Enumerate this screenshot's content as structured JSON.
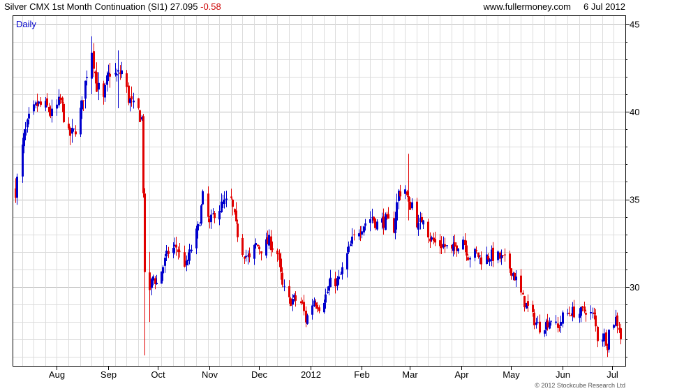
{
  "header": {
    "instrument": "Silver CMX 1st Month Continuation (SI1)",
    "last": "27.095",
    "change": "-0.58",
    "site": "www.fullermoney.com",
    "date": "6 Jul 2012"
  },
  "chart_data": {
    "type": "candlestick",
    "period_label": "Daily",
    "copyright": "© 2012 Stockcube Research Ltd",
    "ylim": [
      25.5,
      45.5
    ],
    "y_ticks": [
      30,
      35,
      40,
      45
    ],
    "grid": true,
    "x_domain": [
      "2011-07-07",
      "2012-07-06"
    ],
    "x_ticks": [
      {
        "date": "2011-08-01",
        "label": "Aug"
      },
      {
        "date": "2011-09-01",
        "label": "Sep"
      },
      {
        "date": "2011-10-01",
        "label": "Oct"
      },
      {
        "date": "2011-11-01",
        "label": "Nov"
      },
      {
        "date": "2011-12-01",
        "label": "Dec"
      },
      {
        "date": "2012-01-01",
        "label": "2012"
      },
      {
        "date": "2012-02-01",
        "label": "Feb"
      },
      {
        "date": "2012-03-01",
        "label": "Mar"
      },
      {
        "date": "2012-04-01",
        "label": "Apr"
      },
      {
        "date": "2012-05-01",
        "label": "May"
      },
      {
        "date": "2012-06-01",
        "label": "Jun"
      },
      {
        "date": "2012-07-01",
        "label": "Jul"
      }
    ],
    "colors": {
      "up": "#0000cc",
      "down": "#e00000",
      "grid": "#dcdcdc",
      "grid_major": "#bdbdbd",
      "axis": "#000000"
    },
    "close_path": [
      [
        "2011-07-07",
        35.5
      ],
      [
        "2011-07-12",
        38.5
      ],
      [
        "2011-07-15",
        39.5
      ],
      [
        "2011-07-20",
        40.4
      ],
      [
        "2011-07-26",
        40.2
      ],
      [
        "2011-07-29",
        39.8
      ],
      [
        "2011-08-03",
        40.6
      ],
      [
        "2011-08-08",
        38.6
      ],
      [
        "2011-08-11",
        38.8
      ],
      [
        "2011-08-16",
        40.3
      ],
      [
        "2011-08-19",
        42.3
      ],
      [
        "2011-08-22",
        43.6
      ],
      [
        "2011-08-25",
        41.5
      ],
      [
        "2011-08-29",
        40.6
      ],
      [
        "2011-08-31",
        41.7
      ],
      [
        "2011-09-02",
        42.3
      ],
      [
        "2011-09-06",
        42.0
      ],
      [
        "2011-09-09",
        42.3
      ],
      [
        "2011-09-13",
        40.8
      ],
      [
        "2011-09-16",
        40.2
      ],
      [
        "2011-09-19",
        40.0
      ],
      [
        "2011-09-21",
        39.6
      ],
      [
        "2011-09-22",
        35.6
      ],
      [
        "2011-09-23",
        30.5
      ],
      [
        "2011-09-26",
        29.9
      ],
      [
        "2011-09-28",
        30.6
      ],
      [
        "2011-09-30",
        30.2
      ],
      [
        "2011-10-04",
        31.2
      ],
      [
        "2011-10-07",
        32.0
      ],
      [
        "2011-10-12",
        32.3
      ],
      [
        "2011-10-14",
        31.9
      ],
      [
        "2011-10-18",
        31.2
      ],
      [
        "2011-10-21",
        32.2
      ],
      [
        "2011-10-25",
        33.3
      ],
      [
        "2011-10-28",
        35.1
      ],
      [
        "2011-11-01",
        33.5
      ],
      [
        "2011-11-04",
        34.3
      ],
      [
        "2011-11-09",
        34.7
      ],
      [
        "2011-11-14",
        34.9
      ],
      [
        "2011-11-17",
        33.4
      ],
      [
        "2011-11-21",
        32.1
      ],
      [
        "2011-11-25",
        31.5
      ],
      [
        "2011-11-29",
        32.4
      ],
      [
        "2011-12-02",
        32.2
      ],
      [
        "2011-12-07",
        32.6
      ],
      [
        "2011-12-12",
        31.9
      ],
      [
        "2011-12-15",
        30.0
      ],
      [
        "2011-12-19",
        29.2
      ],
      [
        "2011-12-22",
        29.3
      ],
      [
        "2011-12-27",
        29.0
      ],
      [
        "2011-12-29",
        28.1
      ],
      [
        "2012-01-03",
        29.3
      ],
      [
        "2012-01-06",
        28.9
      ],
      [
        "2012-01-10",
        29.5
      ],
      [
        "2012-01-13",
        30.2
      ],
      [
        "2012-01-18",
        30.4
      ],
      [
        "2012-01-23",
        31.8
      ],
      [
        "2012-01-26",
        32.6
      ],
      [
        "2012-01-30",
        33.3
      ],
      [
        "2012-02-02",
        33.6
      ],
      [
        "2012-02-07",
        34.0
      ],
      [
        "2012-02-10",
        33.6
      ],
      [
        "2012-02-15",
        33.8
      ],
      [
        "2012-02-20",
        33.4
      ],
      [
        "2012-02-23",
        35.4
      ],
      [
        "2012-02-27",
        35.6
      ],
      [
        "2012-02-29",
        34.6
      ],
      [
        "2012-03-02",
        34.8
      ],
      [
        "2012-03-06",
        33.4
      ],
      [
        "2012-03-09",
        34.1
      ],
      [
        "2012-03-13",
        32.8
      ],
      [
        "2012-03-16",
        32.5
      ],
      [
        "2012-03-21",
        32.4
      ],
      [
        "2012-03-26",
        32.0
      ],
      [
        "2012-03-29",
        32.4
      ],
      [
        "2012-04-02",
        32.8
      ],
      [
        "2012-04-05",
        31.8
      ],
      [
        "2012-04-10",
        31.9
      ],
      [
        "2012-04-13",
        31.6
      ],
      [
        "2012-04-18",
        31.8
      ],
      [
        "2012-04-23",
        31.7
      ],
      [
        "2012-04-27",
        31.5
      ],
      [
        "2012-05-01",
        31.0
      ],
      [
        "2012-05-04",
        30.4
      ],
      [
        "2012-05-08",
        29.3
      ],
      [
        "2012-05-11",
        28.8
      ],
      [
        "2012-05-15",
        28.1
      ],
      [
        "2012-05-18",
        27.7
      ],
      [
        "2012-05-22",
        27.9
      ],
      [
        "2012-05-25",
        28.2
      ],
      [
        "2012-05-29",
        27.6
      ],
      [
        "2012-06-01",
        28.3
      ],
      [
        "2012-06-06",
        28.6
      ],
      [
        "2012-06-11",
        28.5
      ],
      [
        "2012-06-15",
        28.7
      ],
      [
        "2012-06-20",
        28.3
      ],
      [
        "2012-06-22",
        27.1
      ],
      [
        "2012-06-26",
        27.2
      ],
      [
        "2012-06-28",
        26.7
      ],
      [
        "2012-06-29",
        27.5
      ],
      [
        "2012-07-03",
        28.2
      ],
      [
        "2012-07-05",
        27.7
      ],
      [
        "2012-07-06",
        27.1
      ]
    ],
    "spikes": [
      {
        "date": "2011-09-23",
        "low": 26.1,
        "high": 31.5
      },
      {
        "date": "2011-09-26",
        "low": 28.0,
        "high": 32.0
      },
      {
        "date": "2011-08-22",
        "low": 41.0,
        "high": 44.3
      },
      {
        "date": "2011-09-07",
        "low": 40.2,
        "high": 43.5
      },
      {
        "date": "2012-02-29",
        "low": 33.8,
        "high": 37.6
      },
      {
        "date": "2011-07-07",
        "low": 34.8,
        "high": 36.2
      }
    ]
  }
}
